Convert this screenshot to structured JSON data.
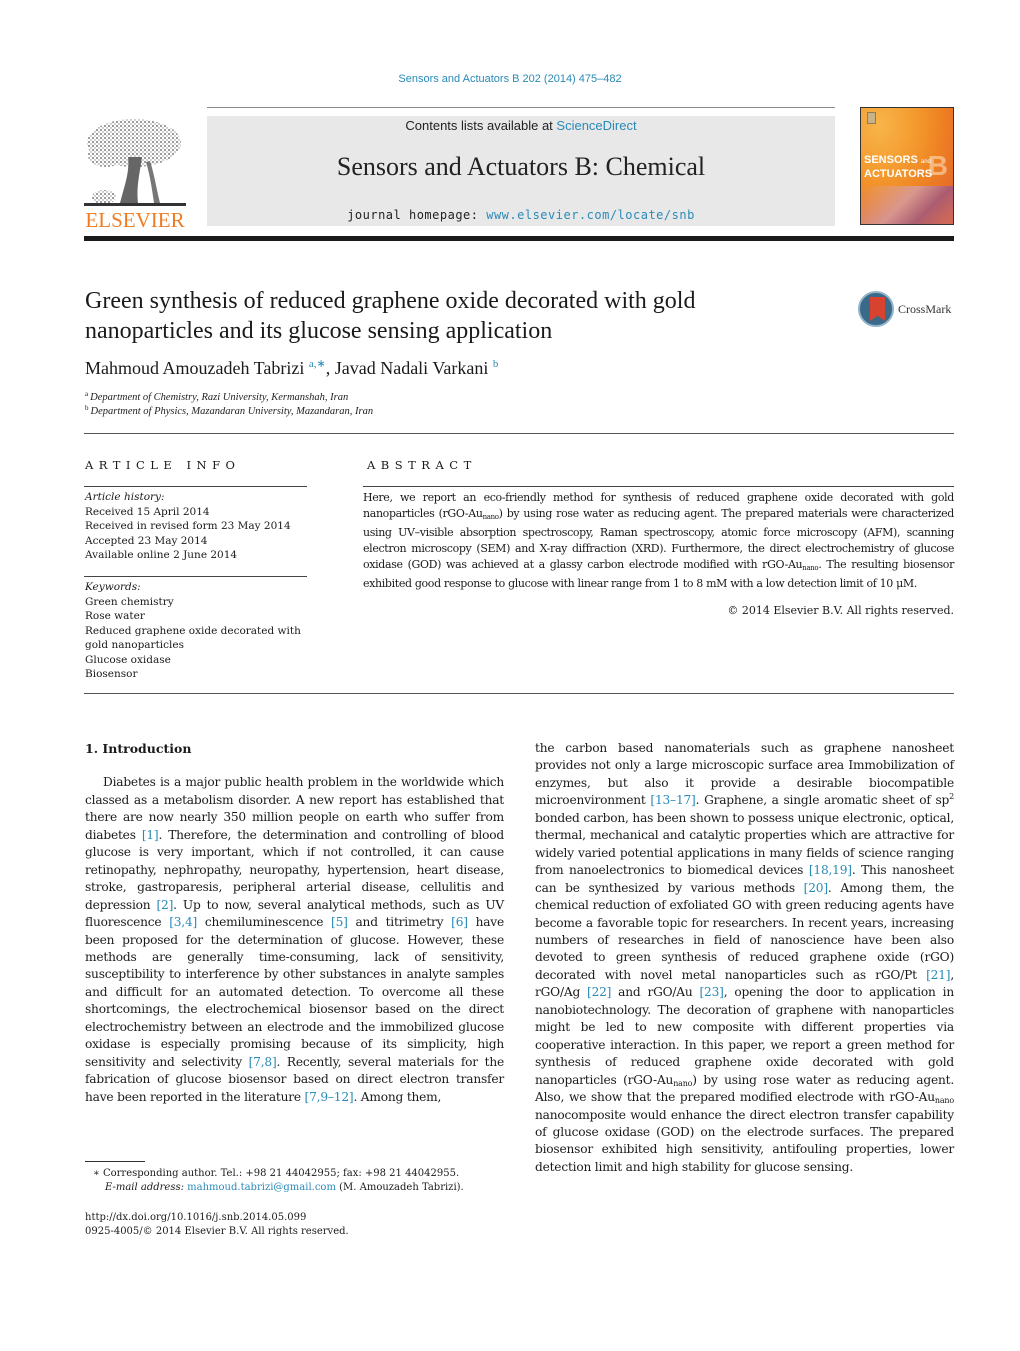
{
  "running_head": "Sensors and Actuators B 202 (2014) 475–482",
  "publisher": {
    "logo_icon": "elsevier-tree-icon",
    "wordmark": "ELSEVIER",
    "brand_color": "#f07b22"
  },
  "banner": {
    "contents_prefix": "Contents lists available at ",
    "contents_link": "ScienceDirect",
    "journal_title": "Sensors and Actuators B: Chemical",
    "homepage_prefix": "journal homepage: ",
    "homepage_link": "www.elsevier.com/locate/snb"
  },
  "cover": {
    "title_line1": "SENSORS",
    "title_and": "and",
    "title_line2": "ACTUATORS",
    "letter": "B"
  },
  "crossmark": {
    "icon": "crossmark-icon",
    "label": "CrossMark"
  },
  "article": {
    "title": "Green synthesis of reduced graphene oxide decorated with gold nanoparticles and its glucose sensing application",
    "authors": [
      {
        "name": "Mahmoud Amouzadeh Tabrizi",
        "marks": "a,∗"
      },
      {
        "name": "Javad Nadali Varkani",
        "marks": "b"
      }
    ],
    "author_separator": ", ",
    "affiliations": [
      {
        "mark": "a",
        "text": "Department of Chemistry, Razi University, Kermanshah, Iran"
      },
      {
        "mark": "b",
        "text": "Department of Physics, Mazandaran University, Mazandaran, Iran"
      }
    ]
  },
  "article_info": {
    "heading": "ARTICLE INFO",
    "history_label": "Article history:",
    "history": [
      "Received 15 April 2014",
      "Received in revised form 23 May 2014",
      "Accepted 23 May 2014",
      "Available online 2 June 2014"
    ],
    "keywords_label": "Keywords:",
    "keywords": [
      "Green chemistry",
      "Rose water",
      "Reduced graphene oxide decorated with gold nanoparticles",
      "Glucose oxidase",
      "Biosensor"
    ]
  },
  "abstract": {
    "heading": "ABSTRACT",
    "parts": {
      "p1": "Here, we report an eco-friendly method for synthesis of reduced graphene oxide decorated with gold nanoparticles (rGO-Au",
      "sub1": "nano",
      "p2": ") by using rose water as reducing agent. The prepared materials were characterized using UV–visible absorption spectroscopy, Raman spectroscopy, atomic force microscopy (AFM), scanning electron microscopy (SEM) and X-ray diffraction (XRD). Furthermore, the direct electrochemistry of glucose oxidase (GOD) was achieved at a glassy carbon electrode modified with rGO-Au",
      "sub2": "nano",
      "p3": ". The resulting biosensor exhibited good response to glucose with linear range from 1 to 8 mM with a low detection limit of 10 μM."
    },
    "copyright": "© 2014 Elsevier B.V. All rights reserved."
  },
  "body": {
    "section_heading": "1.  Introduction",
    "left": {
      "t1": "Diabetes is a major public health problem in the worldwide which classed as a metabolism disorder. A new report has established that there are now nearly 350 million people on earth who suffer from diabetes ",
      "r1": "[1]",
      "t2": ". Therefore, the determination and controlling of blood glucose is very important, which if not controlled, it can cause retinopathy, nephropathy, neuropathy, hypertension, heart disease, stroke, gastroparesis, peripheral arterial disease, cellulitis and depression ",
      "r2": "[2]",
      "t3": ". Up to now, several analytical methods, such as UV fluorescence ",
      "r3": "[3,4]",
      "t4": " chemiluminescence ",
      "r4": "[5]",
      "t5": " and titrimetry ",
      "r5": "[6]",
      "t6": " have been proposed for the determination of glucose. However, these methods are generally time-consuming, lack of sensitivity, susceptibility to interference by other substances in analyte samples and difficult for an automated detection. To overcome all these shortcomings, the electrochemical biosensor based on the direct electrochemistry between an electrode and the immobilized glucose oxidase is especially promising because of its simplicity, high sensitivity and selectivity ",
      "r6": "[7,8]",
      "t7": ". Recently, several materials for the fabrication of glucose biosensor based on direct electron transfer have been reported in the literature ",
      "r7": "[7,9–12]",
      "t8": ". Among them,"
    },
    "right": {
      "t1": "the carbon based nanomaterials such as graphene nanosheet provides not only a large microscopic surface area Immobilization of enzymes, but also it provide a desirable biocompatible microenvironment ",
      "r1": "[13–17]",
      "t2": ". Graphene, a single aromatic sheet of sp",
      "sup1": "2",
      "t3": " bonded carbon, has been shown to possess unique electronic, optical, thermal, mechanical and catalytic properties which are attractive for widely varied potential applications in many fields of science ranging from nanoelectronics to biomedical devices ",
      "r2": "[18,19]",
      "t4": ". This nanosheet can be synthesized by various methods ",
      "r3": "[20]",
      "t5": ". Among them, the chemical reduction of exfoliated GO with green reducing agents have become a favorable topic for researchers. In recent years, increasing numbers of researches in field of nanoscience have been also devoted to green synthesis of reduced graphene oxide (rGO) decorated with novel metal nanoparticles such as rGO/Pt ",
      "r4": "[21]",
      "t6": ", rGO/Ag ",
      "r5": "[22]",
      "t7": " and rGO/Au ",
      "r6": "[23]",
      "t8": ", opening the door to application in nanobiotechnology. The decoration of graphene with nanoparticles might be led to new composite with different properties via cooperative interaction. In this paper, we report a green method for synthesis of reduced graphene oxide decorated with gold nanoparticles (rGO-Au",
      "sub1": "nano",
      "t9": ") by using rose water as reducing agent. Also, we show that the prepared modified electrode with rGO-Au",
      "sub2": "nano",
      "t10": " nanocomposite would enhance the direct electron transfer capability of glucose oxidase (GOD) on the electrode surfaces. The prepared biosensor exhibited high sensitivity, antifouling properties, lower detection limit and high stability for glucose sensing."
    }
  },
  "footnotes": {
    "corresponding": "∗  Corresponding author. Tel.: +98 21 44042955; fax: +98 21 44042955.",
    "email_label": "E-mail address: ",
    "email": "mahmoud.tabrizi@gmail.com",
    "email_suffix": " (M. Amouzadeh Tabrizi).",
    "doi": "http://dx.doi.org/10.1016/j.snb.2014.05.099",
    "issn": "0925-4005/© 2014 Elsevier B.V. All rights reserved."
  },
  "colors": {
    "link": "#2a8ab8",
    "banner_bg": "#e8e8e8",
    "elsevier_orange": "#f07b22"
  }
}
